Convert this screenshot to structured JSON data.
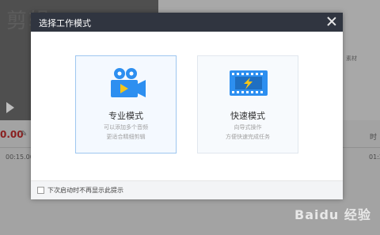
{
  "background": {
    "video_overlay_text": "剪辑",
    "time_display": "0.00",
    "timeline_tick_left": "00:15.00",
    "timeline_tick_right": "01:2",
    "right_label": "时",
    "asset_label": "素材"
  },
  "dialog": {
    "title": "选择工作模式",
    "modes": [
      {
        "label": "专业模式",
        "desc_line1": "可以添加多个音频",
        "desc_line2": "更适合精细剪辑",
        "icon": "film-camera-icon",
        "selected": true
      },
      {
        "label": "快速模式",
        "desc_line1": "向导式操作",
        "desc_line2": "方便快速完成任务",
        "icon": "film-strip-icon",
        "selected": false
      }
    ],
    "footer": {
      "checkbox_label": "下次启动时不再显示此提示",
      "checked": false
    }
  },
  "watermark": "Baidu 经验",
  "colors": {
    "header_bg": "#303540",
    "accent_blue": "#2d8ff0",
    "icon_yellow": "#f5c518",
    "selected_border": "#9ec6ef",
    "time_red": "#8a1f1f"
  }
}
